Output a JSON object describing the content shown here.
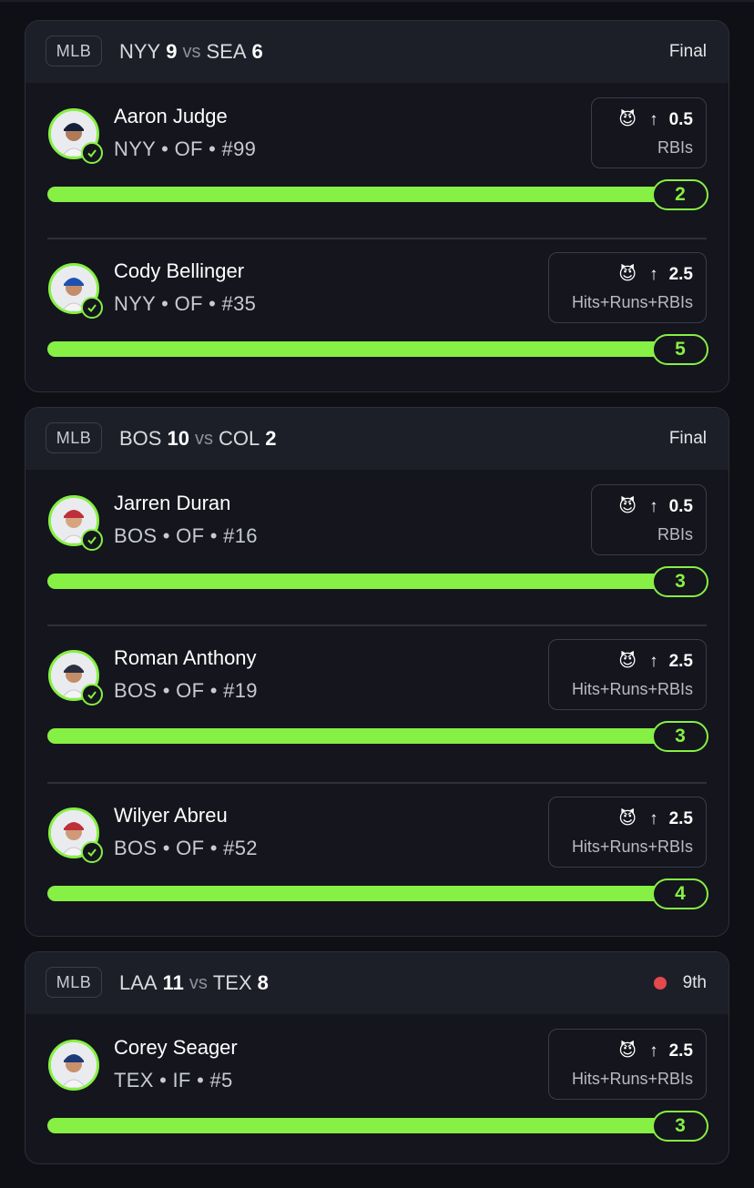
{
  "colors": {
    "accent_green": "#86f044",
    "live_red": "#e5484d",
    "background": "#0f1016",
    "card": "#14151d"
  },
  "icons": {
    "demon": "demon-icon",
    "over": "arrow-up-icon",
    "verified": "check-icon"
  },
  "games": [
    {
      "league": "MLB",
      "away_team": "NYY",
      "away_score": "9",
      "vs": "vs",
      "home_team": "SEA",
      "home_score": "6",
      "status": "Final",
      "live": false,
      "players": [
        {
          "name": "Aaron Judge",
          "meta": "NYY • OF • #99",
          "line": "0.5",
          "stat": "RBIs",
          "result": "2",
          "progress": 1.0
        },
        {
          "name": "Cody Bellinger",
          "meta": "NYY • OF • #35",
          "line": "2.5",
          "stat": "Hits+Runs+RBIs",
          "result": "5",
          "progress": 1.0
        }
      ]
    },
    {
      "league": "MLB",
      "away_team": "BOS",
      "away_score": "10",
      "vs": "vs",
      "home_team": "COL",
      "home_score": "2",
      "status": "Final",
      "live": false,
      "players": [
        {
          "name": "Jarren Duran",
          "meta": "BOS • OF • #16",
          "line": "0.5",
          "stat": "RBIs",
          "result": "3",
          "progress": 1.0
        },
        {
          "name": "Roman Anthony",
          "meta": "BOS • OF • #19",
          "line": "2.5",
          "stat": "Hits+Runs+RBIs",
          "result": "3",
          "progress": 1.0
        },
        {
          "name": "Wilyer Abreu",
          "meta": "BOS • OF • #52",
          "line": "2.5",
          "stat": "Hits+Runs+RBIs",
          "result": "4",
          "progress": 1.0
        }
      ]
    },
    {
      "league": "MLB",
      "away_team": "LAA",
      "away_score": "11",
      "vs": "vs",
      "home_team": "TEX",
      "home_score": "8",
      "status": "9th",
      "live": true,
      "players": [
        {
          "name": "Corey Seager",
          "meta": "TEX • IF • #5",
          "line": "2.5",
          "stat": "Hits+Runs+RBIs",
          "result": "3",
          "progress": 1.0
        }
      ]
    }
  ]
}
